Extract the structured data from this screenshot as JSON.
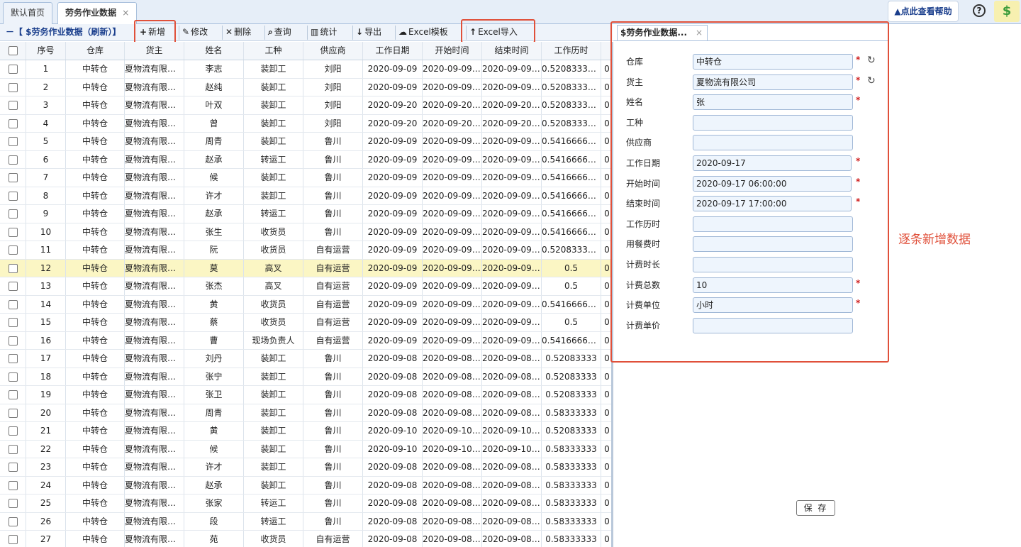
{
  "tabs": [
    {
      "label": "默认首页"
    },
    {
      "label": "劳务作业数据",
      "close": "×"
    }
  ],
  "help": {
    "label": "点此查看帮助",
    "warn": "▲"
  },
  "toolbar": {
    "title": "－【 $劳务作业数据（刷新）】",
    "add": "新增",
    "edit": "修改",
    "delete": "删除",
    "query": "查询",
    "stats": "统计",
    "export": "导出",
    "template": "Excel模板",
    "import": "Excel导入"
  },
  "grid": {
    "columns": [
      "序号",
      "仓库",
      "货主",
      "姓名",
      "工种",
      "供应商",
      "工作日期",
      "开始时间",
      "结束时间",
      "工作历时"
    ],
    "rows": [
      [
        "1",
        "中转仓",
        "夏物流有限公司",
        "李志",
        "装卸工",
        "刘阳",
        "2020-09-09",
        "2020-09-09 ...",
        "2020-09-09 ...",
        "0.52083333..."
      ],
      [
        "2",
        "中转仓",
        "夏物流有限公司",
        "赵纯",
        "装卸工",
        "刘阳",
        "2020-09-09",
        "2020-09-09 ...",
        "2020-09-09 ...",
        "0.52083333..."
      ],
      [
        "3",
        "中转仓",
        "夏物流有限公司",
        "叶双",
        "装卸工",
        "刘阳",
        "2020-09-20",
        "2020-09-20 ...",
        "2020-09-20 ...",
        "0.52083333..."
      ],
      [
        "4",
        "中转仓",
        "夏物流有限公司",
        "曾",
        "装卸工",
        "刘阳",
        "2020-09-20",
        "2020-09-20 ...",
        "2020-09-20 ...",
        "0.52083333..."
      ],
      [
        "5",
        "中转仓",
        "夏物流有限公司",
        "周青",
        "装卸工",
        "鲁川",
        "2020-09-09",
        "2020-09-09 ...",
        "2020-09-09 ...",
        "0.54166666..."
      ],
      [
        "6",
        "中转仓",
        "夏物流有限公司",
        "赵承",
        "转运工",
        "鲁川",
        "2020-09-09",
        "2020-09-09 ...",
        "2020-09-09 ...",
        "0.54166666..."
      ],
      [
        "7",
        "中转仓",
        "夏物流有限公司",
        "候",
        "装卸工",
        "鲁川",
        "2020-09-09",
        "2020-09-09 ...",
        "2020-09-09 ...",
        "0.54166666..."
      ],
      [
        "8",
        "中转仓",
        "夏物流有限公司",
        "许才",
        "装卸工",
        "鲁川",
        "2020-09-09",
        "2020-09-09 ...",
        "2020-09-09 ...",
        "0.54166666..."
      ],
      [
        "9",
        "中转仓",
        "夏物流有限公司",
        "赵承",
        "转运工",
        "鲁川",
        "2020-09-09",
        "2020-09-09 ...",
        "2020-09-09 ...",
        "0.54166666..."
      ],
      [
        "10",
        "中转仓",
        "夏物流有限公司",
        "张生",
        "收货员",
        "鲁川",
        "2020-09-09",
        "2020-09-09 ...",
        "2020-09-09 ...",
        "0.54166666..."
      ],
      [
        "11",
        "中转仓",
        "夏物流有限公司",
        "阮",
        "收货员",
        "自有运营",
        "2020-09-09",
        "2020-09-09 ...",
        "2020-09-09 ...",
        "0.52083333..."
      ],
      [
        "12",
        "中转仓",
        "夏物流有限公司",
        "莫",
        "高叉",
        "自有运营",
        "2020-09-09",
        "2020-09-09 ...",
        "2020-09-09 ...",
        "0.5"
      ],
      [
        "13",
        "中转仓",
        "夏物流有限公司",
        "张杰",
        "高叉",
        "自有运营",
        "2020-09-09",
        "2020-09-09 ...",
        "2020-09-09 ...",
        "0.5"
      ],
      [
        "14",
        "中转仓",
        "夏物流有限公司",
        "黄",
        "收货员",
        "自有运营",
        "2020-09-09",
        "2020-09-09 ...",
        "2020-09-09 ...",
        "0.54166666..."
      ],
      [
        "15",
        "中转仓",
        "夏物流有限公司",
        "蔡",
        "收货员",
        "自有运营",
        "2020-09-09",
        "2020-09-09 ...",
        "2020-09-09 ...",
        "0.5"
      ],
      [
        "16",
        "中转仓",
        "夏物流有限公司",
        "曹",
        "现场负责人",
        "自有运营",
        "2020-09-09",
        "2020-09-09 ...",
        "2020-09-09 ...",
        "0.54166666..."
      ],
      [
        "17",
        "中转仓",
        "夏物流有限公司",
        "刘丹",
        "装卸工",
        "鲁川",
        "2020-09-08",
        "2020-09-08 ...",
        "2020-09-08 ...",
        "0.52083333"
      ],
      [
        "18",
        "中转仓",
        "夏物流有限公司",
        "张宁",
        "装卸工",
        "鲁川",
        "2020-09-08",
        "2020-09-08 ...",
        "2020-09-08 ...",
        "0.52083333"
      ],
      [
        "19",
        "中转仓",
        "夏物流有限公司",
        "张卫",
        "装卸工",
        "鲁川",
        "2020-09-08",
        "2020-09-08 ...",
        "2020-09-08 ...",
        "0.52083333"
      ],
      [
        "20",
        "中转仓",
        "夏物流有限公司",
        "周青",
        "装卸工",
        "鲁川",
        "2020-09-08",
        "2020-09-08 ...",
        "2020-09-08 ...",
        "0.58333333"
      ],
      [
        "21",
        "中转仓",
        "夏物流有限公司",
        "黄",
        "装卸工",
        "鲁川",
        "2020-09-10",
        "2020-09-10 ...",
        "2020-09-10 ...",
        "0.52083333"
      ],
      [
        "22",
        "中转仓",
        "夏物流有限公司",
        "候",
        "装卸工",
        "鲁川",
        "2020-09-10",
        "2020-09-10 ...",
        "2020-09-10 ...",
        "0.58333333"
      ],
      [
        "23",
        "中转仓",
        "夏物流有限公司",
        "许才",
        "装卸工",
        "鲁川",
        "2020-09-08",
        "2020-09-08 ...",
        "2020-09-08 ...",
        "0.58333333"
      ],
      [
        "24",
        "中转仓",
        "夏物流有限公司",
        "赵承",
        "装卸工",
        "鲁川",
        "2020-09-08",
        "2020-09-08 ...",
        "2020-09-08 ...",
        "0.58333333"
      ],
      [
        "25",
        "中转仓",
        "夏物流有限公司",
        "张家",
        "转运工",
        "鲁川",
        "2020-09-08",
        "2020-09-08 ...",
        "2020-09-08 ...",
        "0.58333333"
      ],
      [
        "26",
        "中转仓",
        "夏物流有限公司",
        "段",
        "转运工",
        "鲁川",
        "2020-09-08",
        "2020-09-08 ...",
        "2020-09-08 ...",
        "0.58333333"
      ],
      [
        "27",
        "中转仓",
        "夏物流有限公司",
        "苑",
        "收货员",
        "自有运营",
        "2020-09-08",
        "2020-09-08 ...",
        "2020-09-08 ...",
        "0.58333333"
      ]
    ],
    "selected_row": "12"
  },
  "form": {
    "tab_title": "$劳务作业数据...",
    "tab_close": "×",
    "fields": [
      {
        "label": "仓库",
        "value": "中转仓",
        "required": true,
        "refresh": true
      },
      {
        "label": "货主",
        "value": "夏物流有限公司",
        "required": true,
        "refresh": true
      },
      {
        "label": "姓名",
        "value": "张",
        "required": true,
        "refresh": false
      },
      {
        "label": "工种",
        "value": "",
        "required": false,
        "refresh": false
      },
      {
        "label": "供应商",
        "value": "",
        "required": false,
        "refresh": false
      },
      {
        "label": "工作日期",
        "value": "2020-09-17",
        "required": true,
        "refresh": false
      },
      {
        "label": "开始时间",
        "value": "2020-09-17 06:00:00",
        "required": true,
        "refresh": false
      },
      {
        "label": "结束时间",
        "value": "2020-09-17 17:00:00",
        "required": true,
        "refresh": false
      },
      {
        "label": "工作历时",
        "value": "",
        "required": false,
        "refresh": false
      },
      {
        "label": "用餐费时",
        "value": "",
        "required": false,
        "refresh": false
      },
      {
        "label": "计费时长",
        "value": "",
        "required": false,
        "refresh": false
      },
      {
        "label": "计费总数",
        "value": "10",
        "required": true,
        "refresh": false
      },
      {
        "label": "计费单位",
        "value": "小时",
        "required": true,
        "refresh": false
      },
      {
        "label": "计费单价",
        "value": "",
        "required": false,
        "refresh": false
      }
    ],
    "save": "保 存",
    "required_mark": "*",
    "refresh_icon": "↻"
  },
  "annotation": "逐条新增数据",
  "colors": {
    "accent": "#1a3e8c",
    "highlight": "#e0503a",
    "selected_row": "#fbf6c4"
  }
}
